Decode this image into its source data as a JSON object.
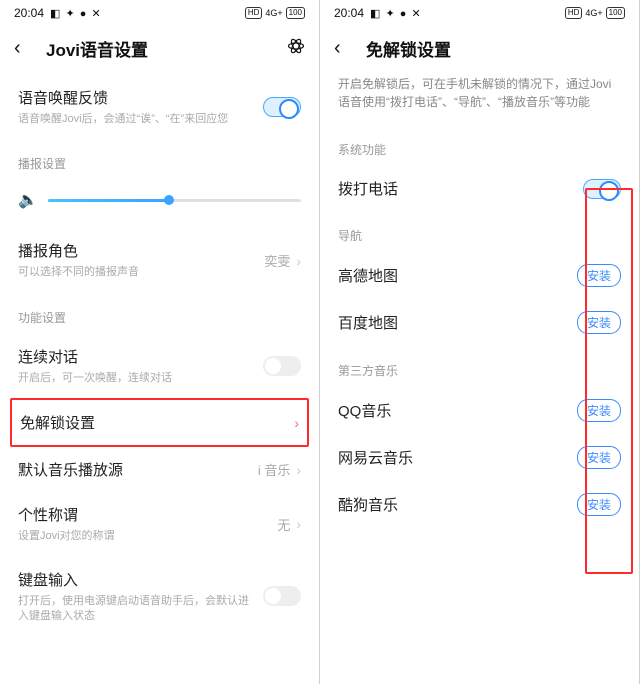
{
  "status": {
    "time": "20:04",
    "indicators": "◧ ✦ ● ✕",
    "net_hd": "HD",
    "net_4g": "4G+",
    "battery": "100"
  },
  "left": {
    "title": "Jovi语音设置",
    "wake": {
      "title": "语音唤醒反馈",
      "sub": "语音唤醒Jovi后，会通过“诶”、“在”来回应您"
    },
    "broadcast_section": "播报设置",
    "role": {
      "title": "播报角色",
      "sub": "可以选择不同的播报声音",
      "value": "奕雯"
    },
    "func_section": "功能设置",
    "continuous": {
      "title": "连续对话",
      "sub": "开启后，可一次唤醒，连续对话"
    },
    "unlock": {
      "title": "免解锁设置"
    },
    "music": {
      "title": "默认音乐播放源",
      "value": "i 音乐"
    },
    "nickname": {
      "title": "个性称谓",
      "sub": "设置Jovi对您的称谓",
      "value": "无"
    },
    "keyboard": {
      "title": "键盘输入",
      "sub": "打开后，使用电源键启动语音助手后，会默认进入键盘输入状态"
    }
  },
  "right": {
    "title": "免解锁设置",
    "desc": "开启免解锁后，可在手机未解锁的情况下，通过Jovi语音使用“拨打电话”、“导航”、“播放音乐”等功能",
    "sys_section": "系统功能",
    "dial": "拨打电话",
    "nav_section": "导航",
    "gaode": "高德地图",
    "baidu": "百度地图",
    "music_section": "第三方音乐",
    "qq": "QQ音乐",
    "netease": "网易云音乐",
    "kugou": "酷狗音乐",
    "install": "安装"
  },
  "slider": {
    "percent": 48
  }
}
